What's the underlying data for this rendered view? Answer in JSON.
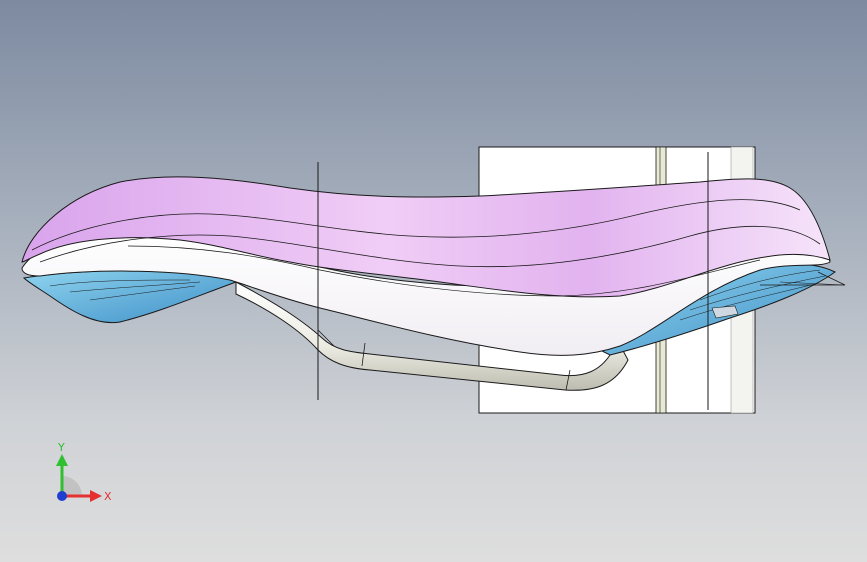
{
  "viewport": {
    "background_top": "#7d8aa0",
    "background_bottom": "#dedede"
  },
  "model": {
    "saddle_top_color": "#e3b8f0",
    "saddle_side_color": "#ffffff",
    "underside_color": "#5fa6d8",
    "rail_color": "#f2f1ea",
    "block_color": "#ffffff",
    "edge_color": "#1a1a1a"
  },
  "triad": {
    "x_label": "X",
    "y_label": "Y",
    "x_color": "#e53030",
    "y_color": "#2fbf2f",
    "z_color": "#1f3fd0"
  }
}
